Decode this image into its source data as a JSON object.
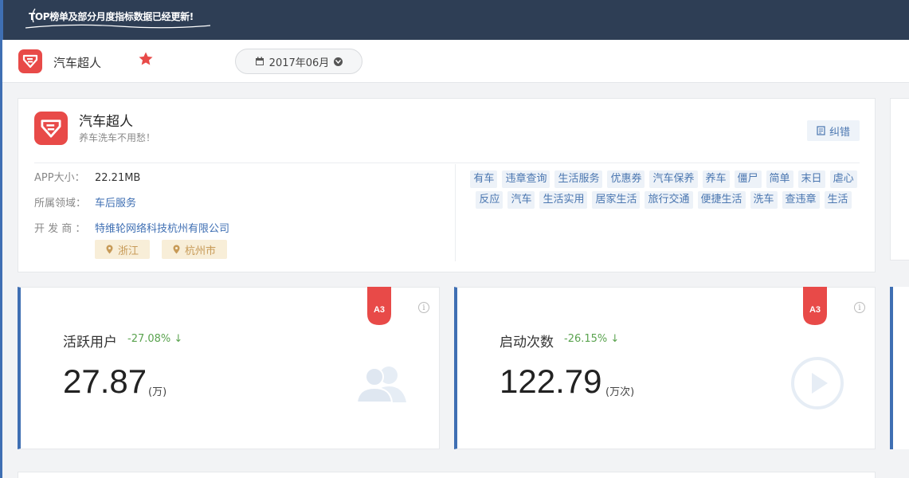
{
  "notice": {
    "text": "TOP榜单及部分月度指标数据已经更新!"
  },
  "header": {
    "app_name": "汽车超人",
    "month": "2017年06月"
  },
  "app_info": {
    "name": "汽车超人",
    "slogan": "养车洗车不用愁！",
    "correct_label": "纠错",
    "size_label": "APP大小：",
    "size_value": "22.21MB",
    "domain_label": "所属领域：",
    "domain_value": "车后服务",
    "developer_label": "开 发 商 ：",
    "developer_value": "特维轮网络科技杭州有限公司",
    "locations": [
      "浙江",
      "杭州市"
    ],
    "tags": [
      "有车",
      "违章查询",
      "生活服务",
      "优惠券",
      "汽车保养",
      "养车",
      "僵尸",
      "简单",
      "末日",
      "虐心",
      "反应",
      "汽车",
      "生活实用",
      "居家生活",
      "旅行交通",
      "便捷生活",
      "洗车",
      "查违章",
      "生活"
    ]
  },
  "metrics": [
    {
      "title": "活跃用户",
      "change": "-27.08%",
      "value": "27.87",
      "unit": "(万)",
      "badge": "A3",
      "icon": "users-icon"
    },
    {
      "title": "启动次数",
      "change": "-26.15%",
      "value": "122.79",
      "unit": "(万次)",
      "badge": "A3",
      "icon": "play-icon"
    }
  ],
  "colors": {
    "topbar": "#2e3e55",
    "accent": "#3f6fb3",
    "brand": "#e84a48",
    "down": "#5aa34f"
  }
}
